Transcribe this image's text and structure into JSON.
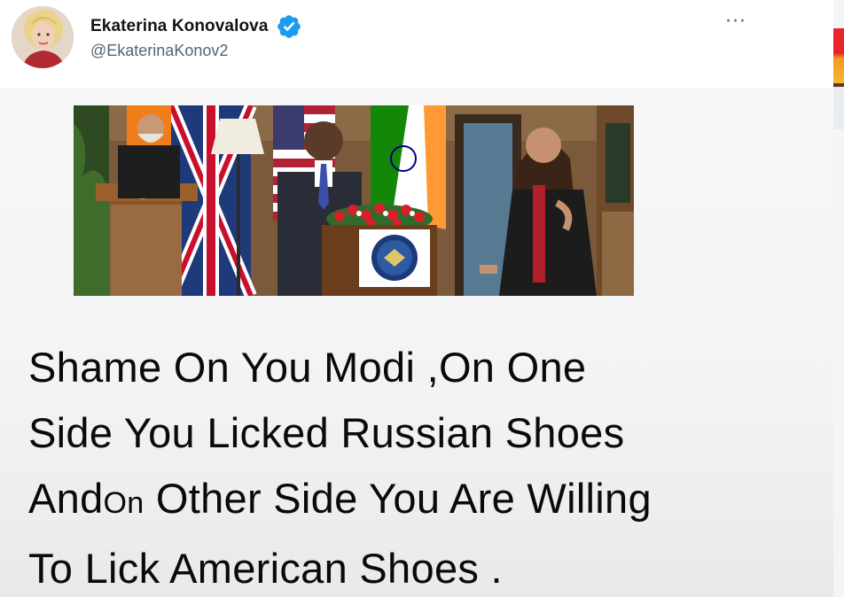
{
  "tweet": {
    "author": {
      "display_name": "Ekaterina Konovalova",
      "handle": "@EkaterinaKonov2",
      "verified": true,
      "verified_icon": "verified-badge-icon",
      "avatar_icon": "avatar"
    },
    "more_label": "···",
    "media": {
      "description_icon": "press-conference-photo"
    },
    "caption": {
      "line1": "Shame On You Modi ,On One",
      "line2": "Side You Licked Russian Shoes",
      "line3_start": "And",
      "line3_small": "On",
      "line3_end": " Other Side You Are Willing",
      "line4": "To Lick American Shoes ."
    }
  },
  "colors": {
    "text": "#0f1419",
    "secondary": "#536471",
    "verified": "#1d9bf0"
  }
}
